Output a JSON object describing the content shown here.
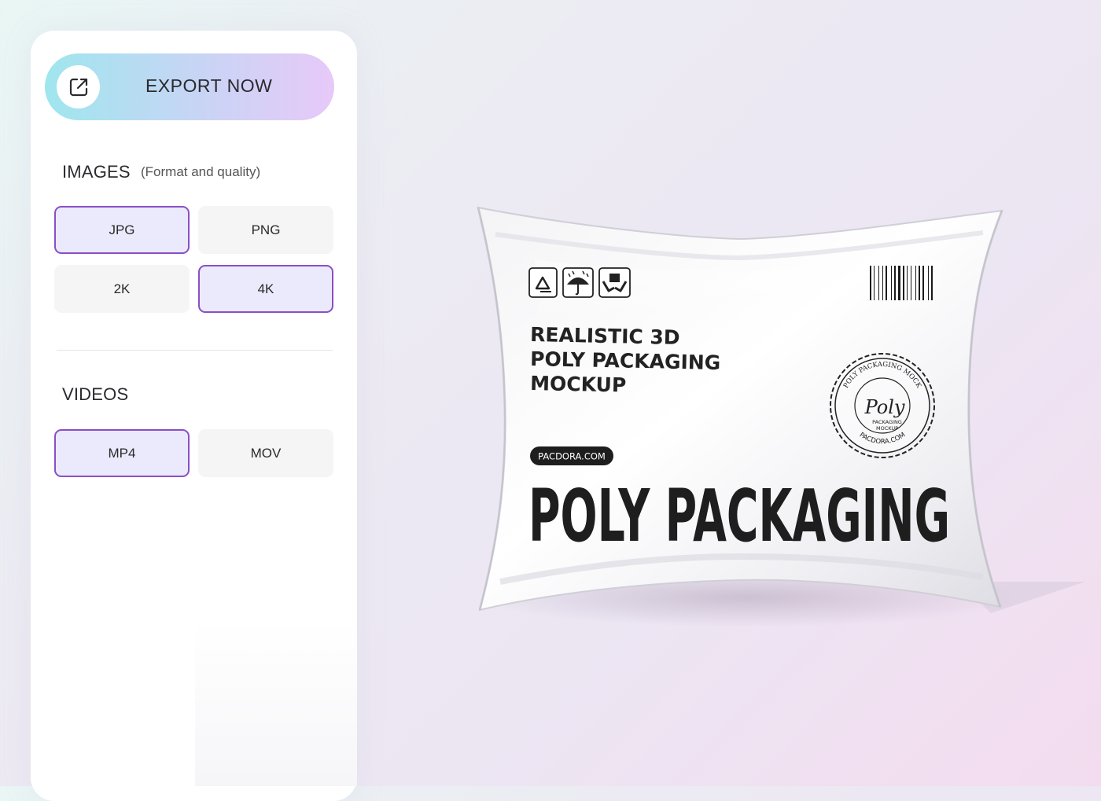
{
  "export": {
    "label": "EXPORT NOW",
    "icon": "external-link-icon"
  },
  "images": {
    "title": "IMAGES",
    "subtitle": "(Format and quality)",
    "options": [
      {
        "label": "JPG",
        "selected": true
      },
      {
        "label": "PNG",
        "selected": false
      },
      {
        "label": "2K",
        "selected": false
      },
      {
        "label": "4K",
        "selected": true
      }
    ]
  },
  "videos": {
    "title": "VIDEOS",
    "options": [
      {
        "label": "MP4",
        "selected": true
      },
      {
        "label": "MOV",
        "selected": false
      }
    ]
  },
  "product": {
    "headline_lines": [
      "REALISTIC 3D",
      "POLY PACKAGING",
      "MOCKUP"
    ],
    "badge": "PACDORA.COM",
    "big_text": "POLY PACKAGING",
    "seal_ring_top": "POLY PACKAGING MOCK",
    "seal_ring_bottom": "PACDORA.COM",
    "seal_script": "Poly",
    "seal_lines": [
      "PACKAGING",
      "MOCKUP"
    ],
    "icons": [
      "recycle-icon",
      "umbrella-icon",
      "handle-with-care-icon"
    ]
  },
  "colors": {
    "accent_border": "#8a4fc6",
    "selected_bg": "#ebeafd"
  }
}
